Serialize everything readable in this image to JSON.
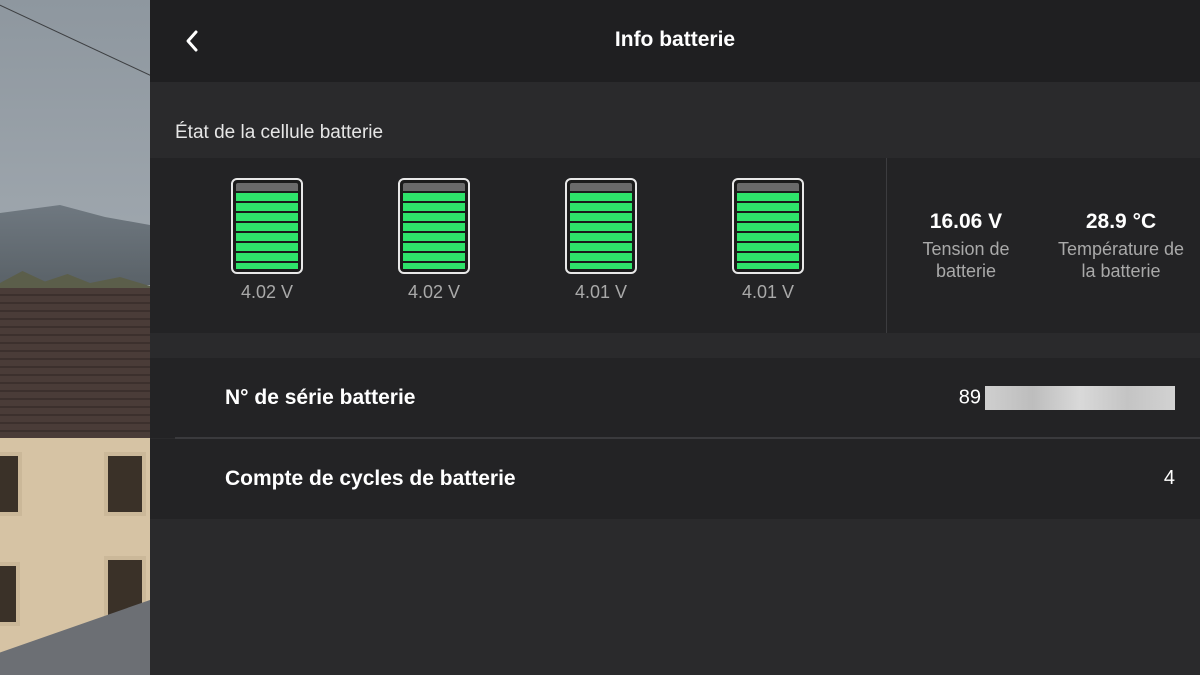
{
  "header": {
    "title": "Info batterie"
  },
  "section": {
    "label": "État de la cellule batterie"
  },
  "cells": [
    {
      "voltage": "4.02 V",
      "level": 1.0
    },
    {
      "voltage": "4.02 V",
      "level": 1.0
    },
    {
      "voltage": "4.01 V",
      "level": 1.0
    },
    {
      "voltage": "4.01 V",
      "level": 1.0
    }
  ],
  "stats": {
    "tension": {
      "value": "16.06 V",
      "label_line1": "Tension de",
      "label_line2": "batterie"
    },
    "temperature": {
      "value": "28.9 °C",
      "label_line1": "Température de",
      "label_line2": "la batterie"
    }
  },
  "rows": {
    "serial": {
      "label": "N° de série batterie",
      "value_prefix": "89"
    },
    "cycles": {
      "label": "Compte de cycles de batterie",
      "value": "4"
    }
  },
  "colors": {
    "cell_fill": "#2ee36a",
    "panel_bg": "#2a2a2c",
    "header_bg": "#1f1f21"
  },
  "icons": {
    "back": "chevron-left-icon"
  }
}
